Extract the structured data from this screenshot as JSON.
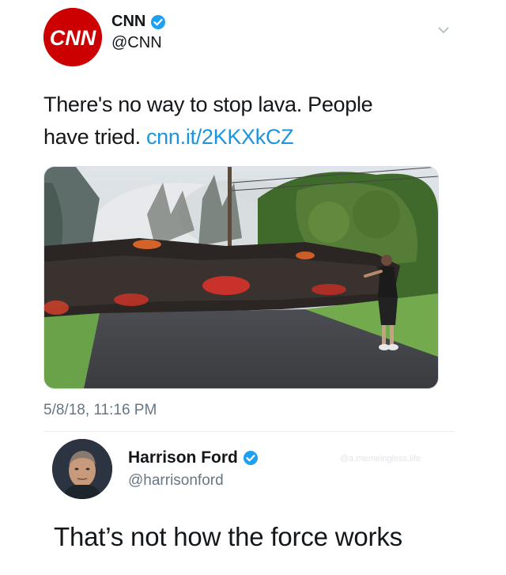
{
  "tweet": {
    "author": {
      "name": "CNN",
      "handle": "@CNN",
      "verified": true,
      "avatar_icon": "cnn-logo-icon",
      "logo_text": "CNN"
    },
    "text_line1": "There's no way to stop lava. People",
    "text_line2_prefix": "have tried. ",
    "link": "cnn.it/2KKXkCZ",
    "media_description": "lava flow crossing a road with a person standing nearby",
    "timestamp": "5/8/18, 11:16 PM"
  },
  "reply": {
    "author": {
      "name": "Harrison Ford",
      "handle": "@harrisonford",
      "verified": true,
      "avatar_icon": "profile-photo-icon"
    },
    "text": "That’s not how the force works"
  },
  "watermark": "@a.memeingless.life",
  "colors": {
    "brand_red": "#cc0000",
    "link_blue": "#1b95e0",
    "verified_blue": "#1da1f2",
    "text": "#14171a",
    "muted": "#657786"
  }
}
